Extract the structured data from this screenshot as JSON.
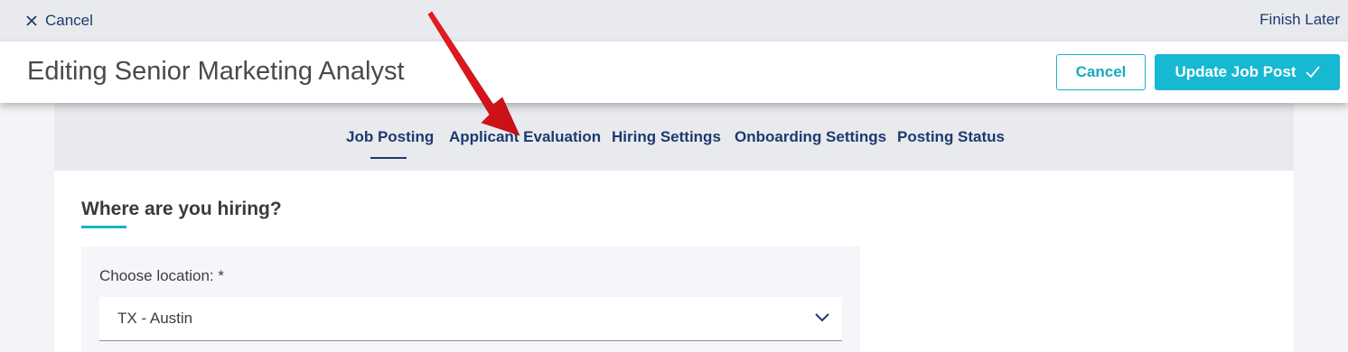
{
  "topbar": {
    "cancel_label": "Cancel",
    "finish_label": "Finish Later"
  },
  "header": {
    "title": "Editing Senior Marketing Analyst",
    "cancel_label": "Cancel",
    "update_label": "Update Job Post"
  },
  "tabs": [
    {
      "label": "Job Posting",
      "active": true
    },
    {
      "label": "Applicant Evaluation",
      "active": false
    },
    {
      "label": "Hiring Settings",
      "active": false
    },
    {
      "label": "Onboarding Settings",
      "active": false
    },
    {
      "label": "Posting Status",
      "active": false
    }
  ],
  "section": {
    "title": "Where are you hiring?",
    "location_label": "Choose location: *",
    "location_value": "TX - Austin"
  },
  "colors": {
    "accent": "#17b8d1",
    "nav_text": "#1d3a6e",
    "annotation_arrow": "#e8141c"
  },
  "icons": {
    "cancel": "close-icon",
    "update": "check-icon",
    "select": "chevron-down-icon"
  }
}
